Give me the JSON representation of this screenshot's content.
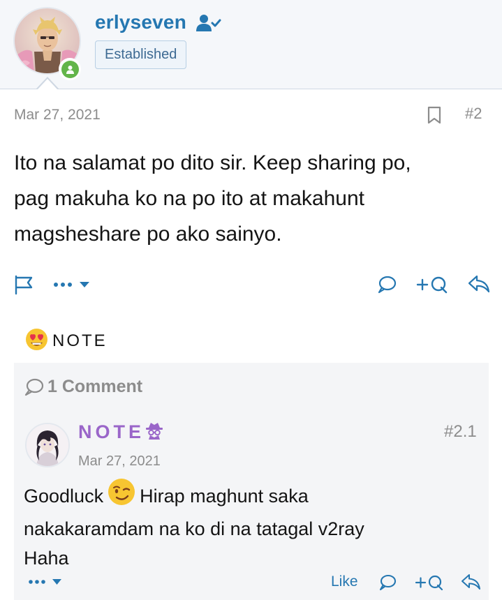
{
  "post": {
    "username": "erlyseven",
    "role_badge": "Established",
    "date": "Mar 27, 2021",
    "number": "#2",
    "body_lines": [
      "Ito na salamat po dito sir. Keep sharing po,",
      "pag makuha ko na po ito at makahunt",
      "magsheshare po ako sainyo."
    ],
    "actions": {
      "more_label": "•••",
      "quote_label": "+Q"
    }
  },
  "reactions": {
    "user": "NOTE",
    "reaction_icon": "heart-eyes-emoji"
  },
  "comments": {
    "count_label": "1 Comment",
    "items": [
      {
        "username": "NOTE",
        "user_icon": "spy-icon",
        "date": "Mar 27, 2021",
        "number": "#2.1",
        "body_part1": "Goodluck",
        "body_part2": "Hirap maghunt saka",
        "body_line2": "nakakaramdam na ko di na tatagal v2ray",
        "body_line3": "Haha",
        "like_label": "Like",
        "quote_label": "+Q",
        "more_label": "•••"
      }
    ]
  },
  "colors": {
    "link": "#2577b1",
    "muted": "#8c8c8c",
    "online": "#63b54a",
    "comment_user": "#9a66c9"
  }
}
